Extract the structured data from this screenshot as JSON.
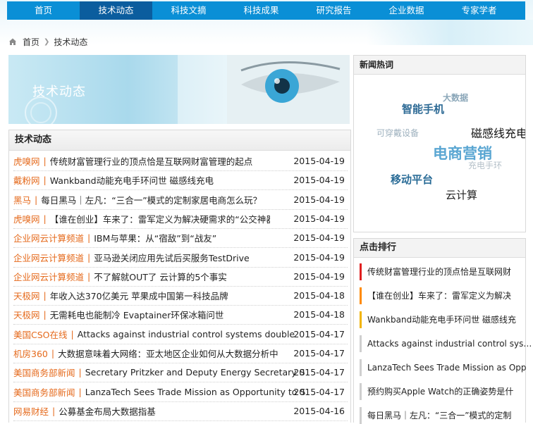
{
  "nav": {
    "items": [
      {
        "label": "首页",
        "active": false
      },
      {
        "label": "技术动态",
        "active": true
      },
      {
        "label": "科技文摘",
        "active": false
      },
      {
        "label": "科技成果",
        "active": false
      },
      {
        "label": "研究报告",
        "active": false
      },
      {
        "label": "企业数据",
        "active": false
      },
      {
        "label": "专家学者",
        "active": false
      }
    ]
  },
  "breadcrumb": {
    "home": "首页",
    "current": "技术动态"
  },
  "banner": {
    "title": "技术动态"
  },
  "news": {
    "heading": "技术动态",
    "rows": [
      {
        "source": "虎嗅网",
        "title": "传统财富管理行业的顶点恰是互联网财富管理的起点",
        "date": "2015-04-19"
      },
      {
        "source": "戴粉网",
        "title": "Wankband动能充电手环问世 磁感线充电",
        "date": "2015-04-19"
      },
      {
        "source": "黑马",
        "title": "每日黑马｜左凡：“三合一”模式的定制家居电商怎么玩？",
        "date": "2015-04-19"
      },
      {
        "source": "虎嗅网",
        "title": "【谁在创业】车来了：雷军定义为解决硬需求的“公交神器”",
        "date": "2015-04-19"
      },
      {
        "source": "企业网云计算频道",
        "title": "IBM与苹果：从“宿敌”到“战友”",
        "date": "2015-04-19"
      },
      {
        "source": "企业网云计算频道",
        "title": "亚马逊关闭应用先试后买服务TestDrive",
        "date": "2015-04-19"
      },
      {
        "source": "企业网云计算频道",
        "title": "不了解就OUT了 云计算的5个事实",
        "date": "2015-04-19"
      },
      {
        "source": "天极网",
        "title": "年收入达370亿美元 苹果成中国第一科技品牌",
        "date": "2015-04-18"
      },
      {
        "source": "天极网",
        "title": "无需耗电也能制冷 Evaptainer环保冰箱问世",
        "date": "2015-04-18"
      },
      {
        "source": "美国CSO在线",
        "title": "Attacks against industrial control systems double",
        "date": "2015-04-17"
      },
      {
        "source": "机房360",
        "title": "大数据意味着大网络：亚太地区企业如何从大数据分析中获益",
        "date": "2015-04-17"
      },
      {
        "source": "美国商务部新闻",
        "title": "Secretary Pritzker and Deputy Energy Secretary Sherwood",
        "date": "2015-04-17"
      },
      {
        "source": "美国商务部新闻",
        "title": "LanzaTech Sees Trade Mission as Opportunity to Strengthen",
        "date": "2015-04-17"
      },
      {
        "source": "网易财经",
        "title": "公募基金布局大数据指基",
        "date": "2015-04-16"
      }
    ]
  },
  "hot": {
    "heading": "新闻热词",
    "words": [
      {
        "text": "大数据",
        "color": "#8aa6b8"
      },
      {
        "text": "智能手机",
        "color": "#2d6a95"
      },
      {
        "text": "可穿戴设备",
        "color": "#9fb2bf"
      },
      {
        "text": "磁感线充电",
        "color": "#111111"
      },
      {
        "text": "电商营销",
        "color": "#5aa6d2"
      },
      {
        "text": "充电手环",
        "color": "#b5c1c9"
      },
      {
        "text": "移动平台",
        "color": "#2a6c97"
      },
      {
        "text": "云计算",
        "color": "#222222"
      }
    ]
  },
  "rank": {
    "heading": "点击排行",
    "items": [
      {
        "title": "传统财富管理行业的顶点恰是互联网财",
        "color": "#e02020"
      },
      {
        "title": "【谁在创业】车来了：雷军定义为解决",
        "color": "#ff8a00"
      },
      {
        "title": "Wankband动能充电手环问世 磁感线充",
        "color": "#f2b400"
      },
      {
        "title": "Attacks against industrial control sys…",
        "color": "#cfcfcf"
      },
      {
        "title": "LanzaTech Sees Trade Mission as Opp",
        "color": "#cfcfcf"
      },
      {
        "title": "预约购买Apple Watch的正确姿势是什",
        "color": "#cfcfcf"
      },
      {
        "title": "每日黑马｜左凡：“三合一”模式的定制",
        "color": "#cfcfcf"
      }
    ]
  }
}
